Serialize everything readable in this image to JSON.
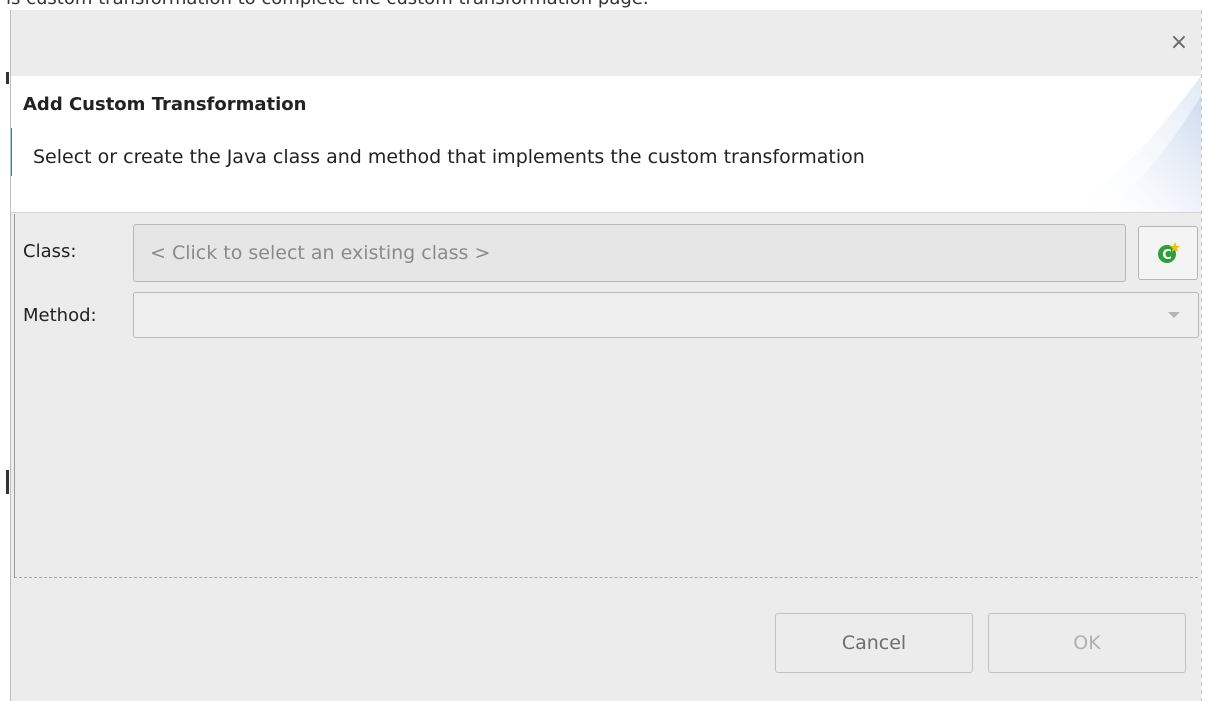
{
  "window": {
    "close_symbol": "×",
    "background_text": "is custom transformation to complete the custom transformation page."
  },
  "banner": {
    "title": "Add Custom Transformation",
    "description": "Select or create the Java class and method that implements the custom transformation"
  },
  "form": {
    "class_label": "Class:",
    "class_placeholder": "< Click to select an existing class >",
    "method_label": "Method:",
    "method_value": "",
    "new_class_icon": "new-class-icon"
  },
  "buttons": {
    "cancel": "Cancel",
    "ok": "OK"
  },
  "colors": {
    "dialog_bg": "#ececec",
    "banner_bg": "#ffffff",
    "new_class_icon_green": "#2e9e3a",
    "new_class_icon_star": "#f2c200",
    "left_accent_blue": "#3d7ab8"
  }
}
